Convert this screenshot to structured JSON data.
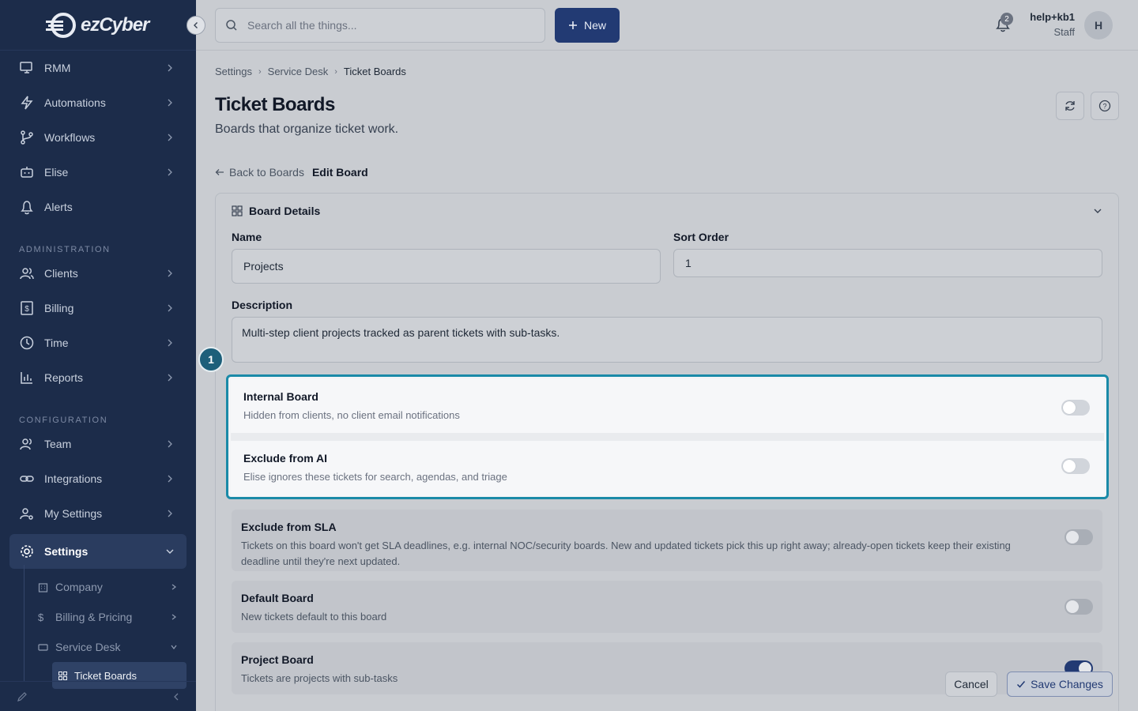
{
  "app": {
    "logo_text": "ezCyber"
  },
  "sidebar": {
    "items": [
      {
        "label": "RMM",
        "icon": "monitor-icon"
      },
      {
        "label": "Automations",
        "icon": "bolt-icon"
      },
      {
        "label": "Workflows",
        "icon": "branch-icon"
      },
      {
        "label": "Elise",
        "icon": "bot-icon"
      },
      {
        "label": "Alerts",
        "icon": "bell-icon"
      }
    ],
    "admin_label": "ADMINISTRATION",
    "admin_items": [
      {
        "label": "Clients",
        "icon": "users-icon"
      },
      {
        "label": "Billing",
        "icon": "dollar-icon"
      },
      {
        "label": "Time",
        "icon": "clock-icon"
      },
      {
        "label": "Reports",
        "icon": "chart-icon"
      }
    ],
    "config_label": "CONFIGURATION",
    "config_items": [
      {
        "label": "Team",
        "icon": "team-icon"
      },
      {
        "label": "Integrations",
        "icon": "link-icon"
      },
      {
        "label": "My Settings",
        "icon": "user-gear-icon"
      }
    ],
    "settings_label": "Settings",
    "settings_sub": [
      {
        "label": "Company"
      },
      {
        "label": "Billing & Pricing"
      },
      {
        "label": "Service Desk"
      }
    ],
    "active_leaf": "Ticket Boards"
  },
  "topbar": {
    "search_placeholder": "Search all the things...",
    "new_label": "New",
    "notification_count": "2",
    "user_name": "help+kb1",
    "user_role": "Staff",
    "avatar_initial": "H"
  },
  "breadcrumb": [
    "Settings",
    "Service Desk",
    "Ticket Boards"
  ],
  "page": {
    "title": "Ticket Boards",
    "subtitle": "Boards that organize ticket work.",
    "back_label": "Back to Boards",
    "edit_label": "Edit Board"
  },
  "card": {
    "title": "Board Details",
    "name_label": "Name",
    "name_value": "Projects",
    "sort_label": "Sort Order",
    "sort_value": "1",
    "desc_label": "Description",
    "desc_value": "Multi-step client projects tracked as parent tickets with sub-tasks."
  },
  "toggles": [
    {
      "title": "Internal Board",
      "desc": "Hidden from clients, no client email notifications",
      "on": false
    },
    {
      "title": "Exclude from AI",
      "desc": "Elise ignores these tickets for search, agendas, and triage",
      "on": false
    },
    {
      "title": "Exclude from SLA",
      "desc": "Tickets on this board won't get SLA deadlines, e.g. internal NOC/security boards. New and updated tickets pick this up right away; already-open tickets keep their existing deadline until they're next updated.",
      "on": false
    },
    {
      "title": "Default Board",
      "desc": "New tickets default to this board",
      "on": false
    },
    {
      "title": "Project Board",
      "desc": "Tickets are projects with sub-tasks",
      "on": true
    }
  ],
  "step_badge": "1",
  "actions": {
    "cancel_label": "Cancel",
    "save_label": "Save Changes"
  },
  "colors": {
    "sidebar": "#1c2c4a",
    "accent": "#223a73",
    "highlight": "#1a8aa8"
  }
}
